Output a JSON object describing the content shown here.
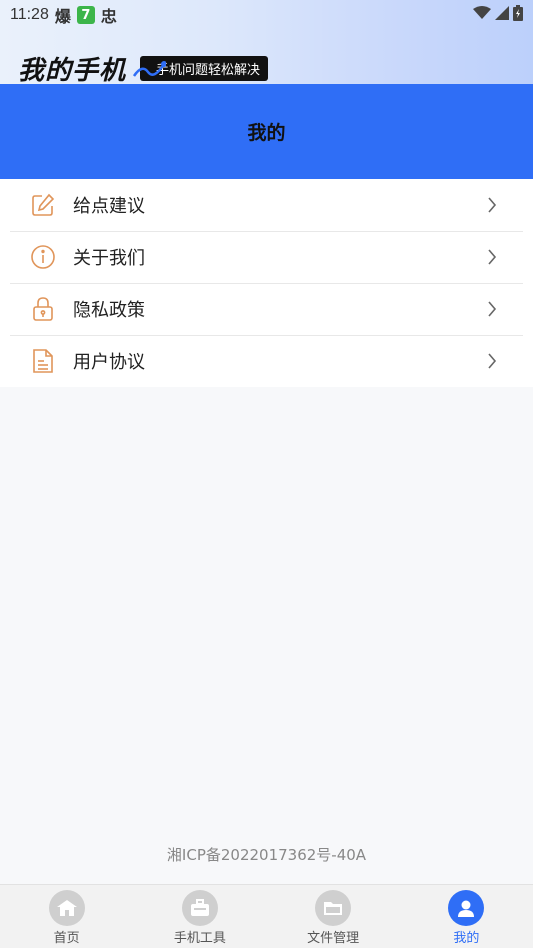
{
  "status_bar": {
    "time": "11:28",
    "notif_1": "爆",
    "notif_2": "7",
    "notif_3": "忠"
  },
  "brand": {
    "title": "我的手机",
    "tagline": "手机问题轻松解决"
  },
  "header": {
    "title": "我的"
  },
  "menu": {
    "items": [
      {
        "label": "给点建议",
        "icon": "edit-icon"
      },
      {
        "label": "关于我们",
        "icon": "info-icon"
      },
      {
        "label": "隐私政策",
        "icon": "lock-icon"
      },
      {
        "label": "用户协议",
        "icon": "document-icon"
      }
    ]
  },
  "footer": {
    "icp": "湘ICP备2022017362号-40A"
  },
  "bottom_nav": {
    "items": [
      {
        "label": "首页",
        "icon": "home-icon",
        "active": false
      },
      {
        "label": "手机工具",
        "icon": "toolbox-icon",
        "active": false
      },
      {
        "label": "文件管理",
        "icon": "folder-icon",
        "active": false
      },
      {
        "label": "我的",
        "icon": "user-icon",
        "active": true
      }
    ]
  },
  "colors": {
    "accent": "#2f6ef6",
    "icon_orange": "#e0955a",
    "nav_inactive": "#cfcfcf"
  }
}
